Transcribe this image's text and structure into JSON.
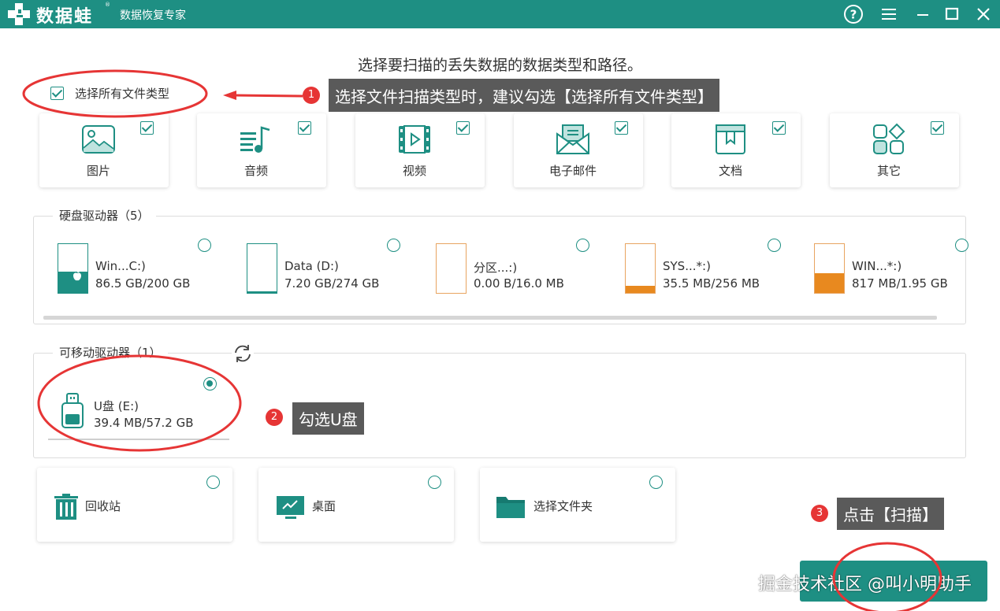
{
  "app": {
    "brand": "数据蛙",
    "registered_mark": "®",
    "subtitle": "数据恢复专家"
  },
  "window_controls": [
    {
      "name": "help-icon"
    },
    {
      "name": "menu-icon"
    },
    {
      "name": "minimize-icon"
    },
    {
      "name": "maximize-icon"
    },
    {
      "name": "close-icon"
    }
  ],
  "heading": "选择要扫描的丢失数据的数据类型和路径。",
  "select_all": {
    "label": "选择所有文件类型",
    "checked": true
  },
  "file_types": [
    {
      "label": "图片",
      "icon": "image-icon",
      "checked": true
    },
    {
      "label": "音频",
      "icon": "audio-icon",
      "checked": true
    },
    {
      "label": "视频",
      "icon": "video-icon",
      "checked": true
    },
    {
      "label": "电子邮件",
      "icon": "email-icon",
      "checked": true
    },
    {
      "label": "文档",
      "icon": "document-icon",
      "checked": true
    },
    {
      "label": "其它",
      "icon": "other-icon",
      "checked": true
    }
  ],
  "hard_drives": {
    "title": "硬盘驱动器（5）",
    "items": [
      {
        "name": "Win...C:)",
        "size": "86.5 GB/200 GB",
        "used_fraction": 0.43,
        "color": "#1e8f83",
        "os_logo": true
      },
      {
        "name": "Data (D:)",
        "size": "7.20 GB/274 GB",
        "used_fraction": 0.03,
        "color": "#1e8f83"
      },
      {
        "name": "分区...:)",
        "size": "0.00  B/16.0 MB",
        "used_fraction": 0.0,
        "color": "#e8a460"
      },
      {
        "name": "SYS...*:)",
        "size": "35.5 MB/256 MB",
        "used_fraction": 0.14,
        "color": "#e8891f"
      },
      {
        "name": "WIN...*:)",
        "size": "817 MB/1.95 GB",
        "used_fraction": 0.41,
        "color": "#e8891f"
      }
    ]
  },
  "removable": {
    "title": "可移动驱动器（1）",
    "items": [
      {
        "name": "U盘 (E:)",
        "size": "39.4 MB/57.2 GB",
        "selected": true
      }
    ]
  },
  "locations": [
    {
      "label": "回收站",
      "icon": "recycle-bin-icon"
    },
    {
      "label": "桌面",
      "icon": "desktop-icon"
    },
    {
      "label": "选择文件夹",
      "icon": "folder-icon"
    }
  ],
  "callouts": [
    {
      "num": "1",
      "text": "选择文件扫描类型时，建议勾选【选择所有文件类型】"
    },
    {
      "num": "2",
      "text": "勾选U盘"
    },
    {
      "num": "3",
      "text": "点击【扫描】"
    }
  ],
  "watermark": "掘金技术社区 @叫小明助手",
  "colors": {
    "accent": "#1e8f83",
    "warning": "#e8891f",
    "badge": "#e63535",
    "annotation": "#e63535"
  }
}
